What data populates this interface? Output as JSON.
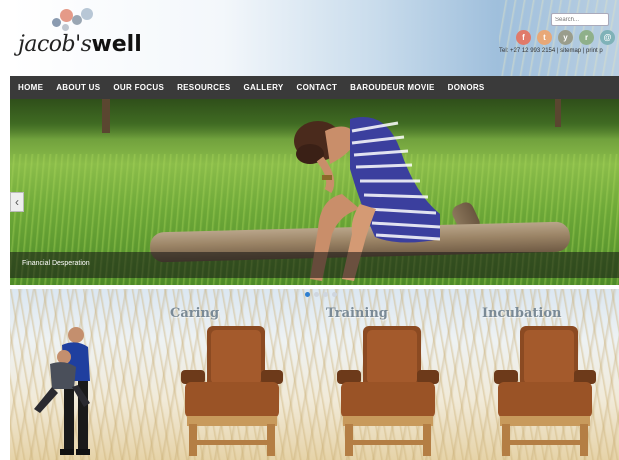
{
  "header": {
    "logo_script": "jacob's",
    "logo_bold": "well",
    "search_placeholder": "Search...",
    "social_icons": [
      {
        "name": "facebook-icon",
        "glyph": "f",
        "color": "#e07a6a"
      },
      {
        "name": "twitter-icon",
        "glyph": "t",
        "color": "#e8a878"
      },
      {
        "name": "youtube-icon",
        "glyph": "y",
        "color": "#9a9d8c"
      },
      {
        "name": "rss-icon",
        "glyph": "r",
        "color": "#8fb08a"
      },
      {
        "name": "email-icon",
        "glyph": "@",
        "color": "#7fb2b8"
      }
    ],
    "tel": "Tel: +27 12 993 2154",
    "sitemap": "sitemap",
    "print": "print p"
  },
  "nav": {
    "items": [
      "HOME",
      "ABOUT US",
      "OUR FOCUS",
      "RESOURCES",
      "GALLERY",
      "CONTACT",
      "BAROUDEUR MOVIE",
      "DONORS"
    ]
  },
  "slider": {
    "caption": "Financial Desperation",
    "prev_glyph": "‹",
    "dot_count": 4,
    "active_dot": 0
  },
  "banner": {
    "labels": [
      "Caring",
      "Training",
      "Incubation"
    ]
  },
  "colors": {
    "nav_bg": "#3a3a3a",
    "active_dot": "#2f7fd0"
  }
}
